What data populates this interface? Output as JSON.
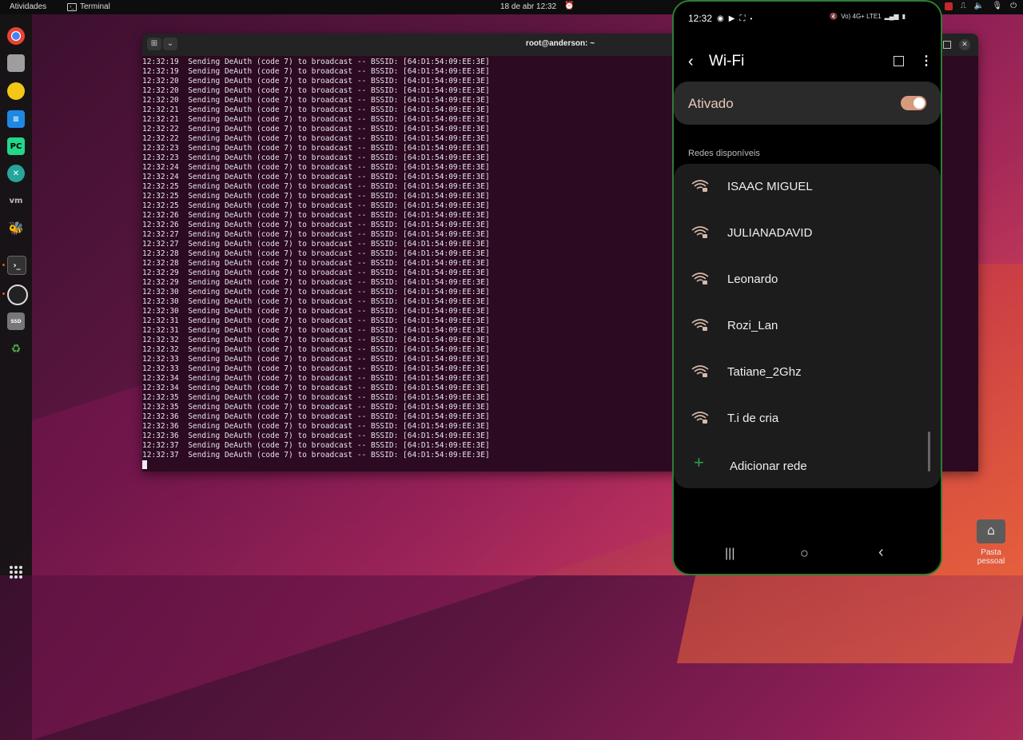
{
  "topbar": {
    "activities": "Atividades",
    "app_name": "Terminal",
    "clock": "18 de abr  12:32"
  },
  "terminal": {
    "title": "root@anderson: ~",
    "message": "Sending DeAuth (code 7) to broadcast -- BSSID: [64:D1:54:09:EE:3E]",
    "timestamps": [
      "12:32:19",
      "12:32:19",
      "12:32:20",
      "12:32:20",
      "12:32:20",
      "12:32:21",
      "12:32:21",
      "12:32:22",
      "12:32:22",
      "12:32:23",
      "12:32:23",
      "12:32:24",
      "12:32:24",
      "12:32:25",
      "12:32:25",
      "12:32:25",
      "12:32:26",
      "12:32:26",
      "12:32:27",
      "12:32:27",
      "12:32:28",
      "12:32:28",
      "12:32:29",
      "12:32:29",
      "12:32:30",
      "12:32:30",
      "12:32:30",
      "12:32:31",
      "12:32:31",
      "12:32:32",
      "12:32:32",
      "12:32:33",
      "12:32:33",
      "12:32:34",
      "12:32:34",
      "12:32:35",
      "12:32:35",
      "12:32:36",
      "12:32:36",
      "12:32:36",
      "12:32:37",
      "12:32:37"
    ]
  },
  "phone": {
    "status_time": "12:32",
    "status_right": "Vo) 4G+ LTE1",
    "header_title": "Wi-Fi",
    "toggle_label": "Ativado",
    "section_label": "Redes disponíveis",
    "networks": [
      "ISAAC MIGUEL",
      "JULIANADAVID",
      "Leonardo",
      "Rozi_Lan",
      "Tatiane_2Ghz",
      "T.i de cria"
    ],
    "add_network": "Adicionar rede"
  },
  "desktop": {
    "home_folder": "Pasta pessoal"
  }
}
